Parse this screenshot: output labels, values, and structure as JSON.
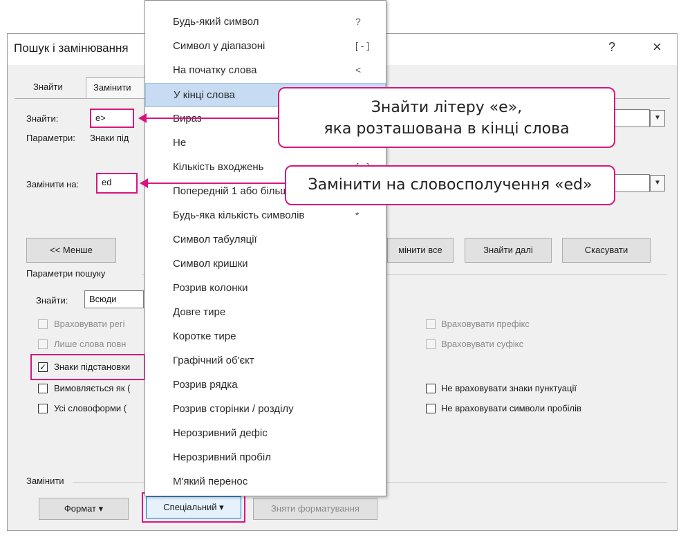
{
  "window": {
    "title": "Пошук і замінювання",
    "help_glyph": "?",
    "close_glyph": "×"
  },
  "tabs": [
    {
      "label": "Знайти"
    },
    {
      "label": "Замінити"
    }
  ],
  "find": {
    "label": "Знайти:",
    "value": "e>"
  },
  "params": {
    "label": "Параметри:",
    "value": "Знаки під"
  },
  "replace": {
    "label": "Замінити на:",
    "value": "ed"
  },
  "buttons": {
    "less": "<< Менше",
    "replace_all": "мінити все",
    "find_next": "Знайти далі",
    "cancel": "Скасувати",
    "format": "Формат ▾",
    "special": "Спеціальний ▾",
    "clear_format": "Зняти форматування"
  },
  "search_options": {
    "section_label": "Параметри пошуку",
    "find_in_label": "Знайти:",
    "find_in_value": "Всюди",
    "left": [
      {
        "label": "Враховувати регі",
        "checked": false,
        "disabled": true
      },
      {
        "label": "Лише слова повн",
        "checked": false,
        "disabled": true
      },
      {
        "label": "Знаки підстановки",
        "checked": true,
        "disabled": false
      },
      {
        "label": "Вимовляється як (",
        "checked": false,
        "disabled": false
      },
      {
        "label": "Усі словоформи (",
        "checked": false,
        "disabled": false
      }
    ],
    "right": [
      {
        "label": "Враховувати префікс",
        "checked": false,
        "disabled": true
      },
      {
        "label": "Враховувати суфікс",
        "checked": false,
        "disabled": true
      },
      {
        "label": "Не враховувати знаки пунктуації",
        "checked": false,
        "disabled": false
      },
      {
        "label": "Не враховувати символи пробілів",
        "checked": false,
        "disabled": false
      }
    ]
  },
  "replace_section": {
    "label": "Замінити"
  },
  "special_menu": {
    "items": [
      {
        "label": "Будь-який символ",
        "key": "?"
      },
      {
        "label": "Символ у діапазоні",
        "key": "[ - ]"
      },
      {
        "label": "На початку слова",
        "key": "<"
      },
      {
        "label": "У кінці слова",
        "key": ">",
        "selected": true
      },
      {
        "label": "Вираз",
        "key": "( )"
      },
      {
        "label": "Не",
        "key": "[!]"
      },
      {
        "label": "Кількість входжень",
        "key": "{ , }"
      },
      {
        "label": "Попередній 1 або більше",
        "key": "@"
      },
      {
        "label": "Будь-яка кількість символів",
        "key": "*"
      },
      {
        "label": "Символ табуляції",
        "key": ""
      },
      {
        "label": "Символ кришки",
        "key": ""
      },
      {
        "label": "Розрив колонки",
        "key": ""
      },
      {
        "label": "Довге тире",
        "key": ""
      },
      {
        "label": "Коротке тире",
        "key": ""
      },
      {
        "label": "Графічний об'єкт",
        "key": ""
      },
      {
        "label": "Розрив рядка",
        "key": ""
      },
      {
        "label": "Розрив сторінки / розділу",
        "key": ""
      },
      {
        "label": "Нерозривний дефіс",
        "key": ""
      },
      {
        "label": "Нерозривний пробіл",
        "key": ""
      },
      {
        "label": "М'який перенос",
        "key": ""
      }
    ]
  },
  "callouts": {
    "find_line1": "Знайти літеру «e»,",
    "find_line2": "яка розташована в кінці слова",
    "replace": "Замінити на словосполучення «ed»"
  },
  "colors": {
    "accent": "#d6167e",
    "menu_selection": "#c7dcf2"
  }
}
